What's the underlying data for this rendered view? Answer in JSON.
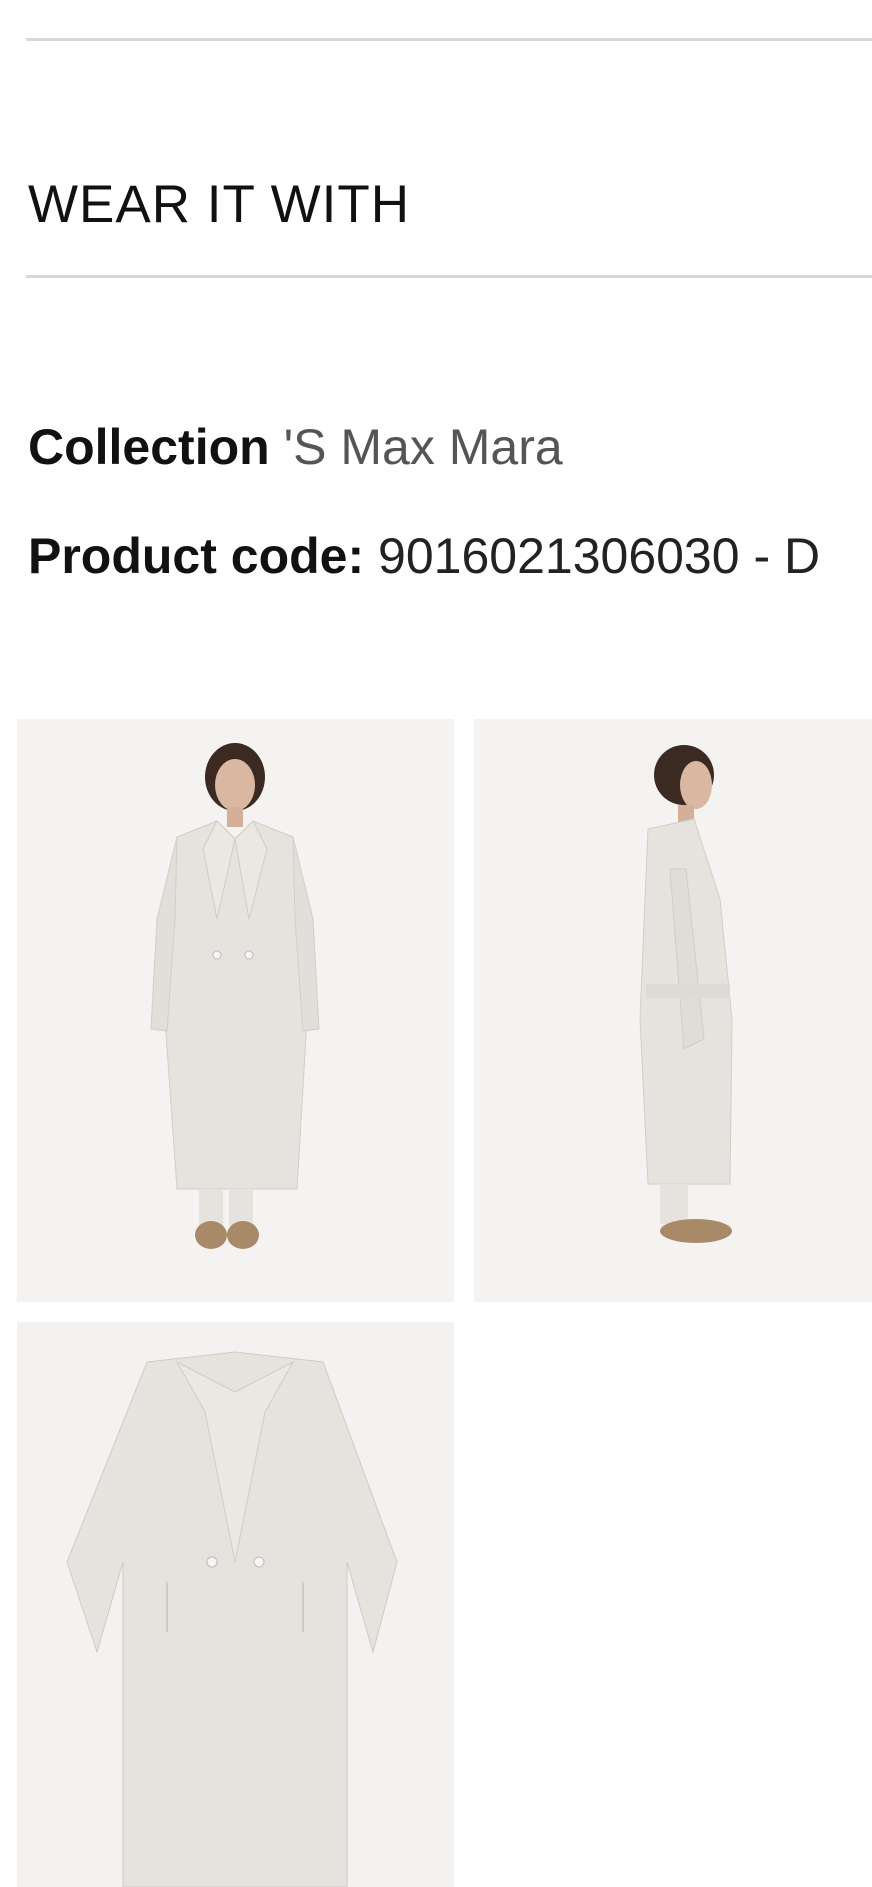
{
  "section": {
    "title": "WEAR IT WITH"
  },
  "product": {
    "collection_label": "Collection",
    "collection_value": "'S Max Mara",
    "code_label": "Product code:",
    "code_value": "9016021306030 - D"
  },
  "gallery": {
    "images": [
      {
        "name": "model-front-photo"
      },
      {
        "name": "model-side-photo"
      },
      {
        "name": "coat-flat-photo"
      }
    ]
  },
  "colors": {
    "divider": "#d8d8d8",
    "coat": "#e6e3de",
    "background": "#f3f2f0"
  }
}
